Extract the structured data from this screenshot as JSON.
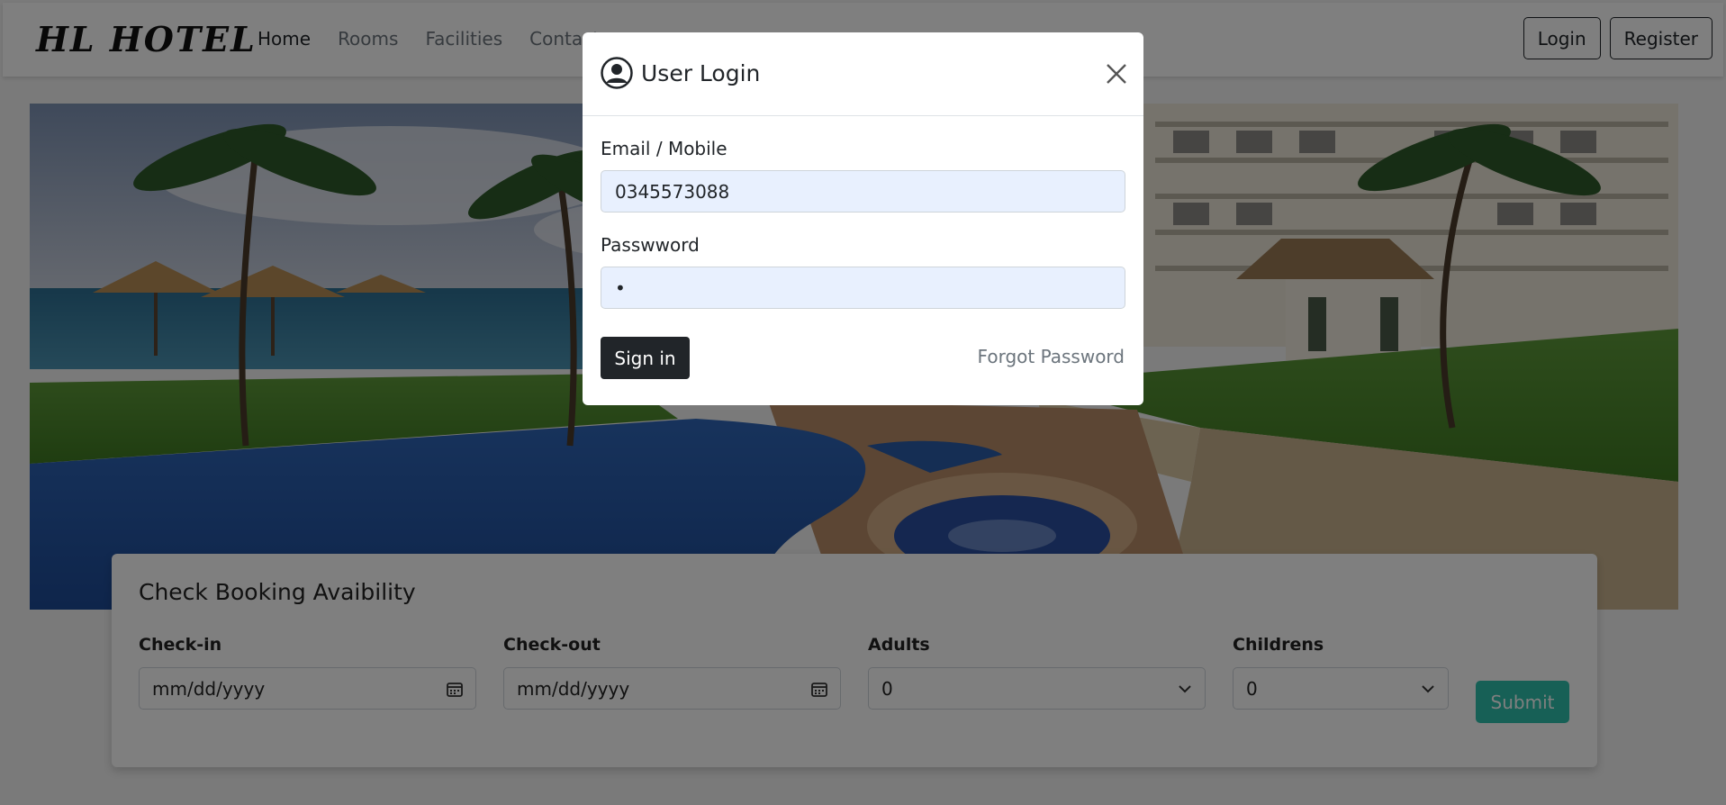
{
  "navbar": {
    "brand": "HL HOTEL",
    "links": [
      {
        "label": "Home"
      },
      {
        "label": "Rooms"
      },
      {
        "label": "Facilities"
      },
      {
        "label": "Contact us"
      }
    ],
    "login_label": "Login",
    "register_label": "Register"
  },
  "booking": {
    "title": "Check Booking Avaibility",
    "checkin": {
      "label": "Check-in",
      "placeholder": "mm/dd/yyyy"
    },
    "checkout": {
      "label": "Check-out",
      "placeholder": "mm/dd/yyyy"
    },
    "adults": {
      "label": "Adults",
      "value": "0"
    },
    "children": {
      "label": "Childrens",
      "value": "0"
    },
    "submit_label": "Submit"
  },
  "modal": {
    "title": "User Login",
    "email_label": "Email / Mobile",
    "email_value": "0345573088",
    "password_label": "Passwword",
    "password_value": "•",
    "signin_label": "Sign in",
    "forgot_label": "Forgot Password"
  },
  "colors": {
    "accent": "#2ec1ac",
    "dark": "#212529",
    "autofill": "#e8f0fe"
  },
  "icons": {
    "user": "user-circle-icon",
    "close": "close-icon",
    "calendar": "calendar-icon",
    "chevron": "chevron-down-icon"
  }
}
